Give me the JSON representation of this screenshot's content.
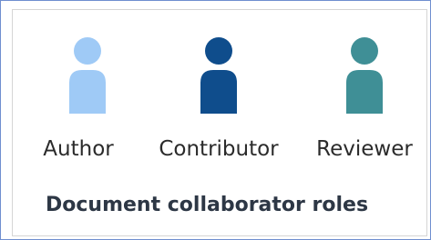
{
  "roles": [
    {
      "label": "Author",
      "icon": "person-icon",
      "color": "#9fcaf6"
    },
    {
      "label": "Contributor",
      "icon": "person-icon",
      "color": "#0f4d8c"
    },
    {
      "label": "Reviewer",
      "icon": "person-icon",
      "color": "#3f8f96"
    }
  ],
  "caption": "Document collaborator roles",
  "colors": {
    "frame_border": "#6f8fcf",
    "inner_border": "#d5d5d5",
    "text": "#2b2b2b"
  }
}
